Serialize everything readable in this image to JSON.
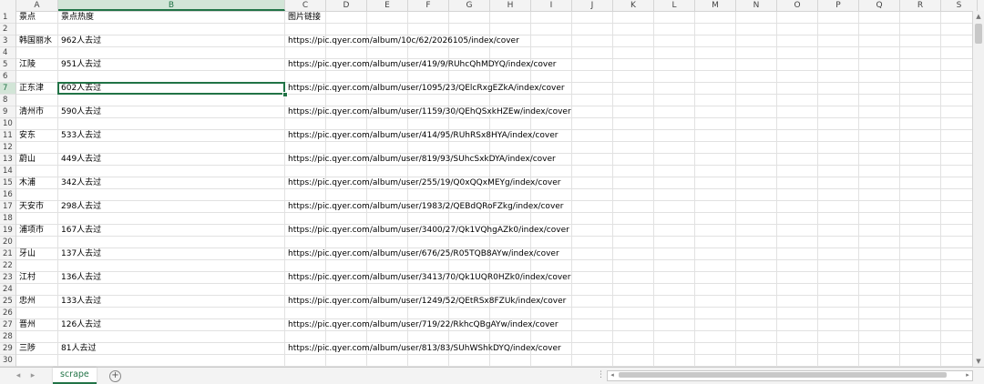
{
  "columns": [
    "A",
    "B",
    "C",
    "D",
    "E",
    "F",
    "G",
    "H",
    "I",
    "J",
    "K",
    "L",
    "M",
    "N",
    "O",
    "P",
    "Q",
    "R",
    "S"
  ],
  "selected_column": "B",
  "selected_row": "7",
  "row_numbers": [
    "1",
    "2",
    "3",
    "4",
    "5",
    "6",
    "7",
    "8",
    "9",
    "10",
    "11",
    "12",
    "13",
    "14",
    "15",
    "16",
    "17",
    "18",
    "19",
    "20",
    "21",
    "22",
    "23",
    "24",
    "25",
    "26",
    "27",
    "28",
    "29",
    "30"
  ],
  "header_row": {
    "a": "景点",
    "b": "景点热度",
    "c": "图片链接"
  },
  "rows": [
    {
      "row": 3,
      "a": "韩国丽水",
      "b": "962人去过",
      "c": "https://pic.qyer.com/album/10c/62/2026105/index/cover"
    },
    {
      "row": 5,
      "a": "江陵",
      "b": "951人去过",
      "c": "https://pic.qyer.com/album/user/419/9/RUhcQhMDYQ/index/cover"
    },
    {
      "row": 7,
      "a": "正东津",
      "b": "602人去过",
      "c": "https://pic.qyer.com/album/user/1095/23/QElcRxgEZkA/index/cover"
    },
    {
      "row": 9,
      "a": "清州市",
      "b": "590人去过",
      "c": "https://pic.qyer.com/album/user/1159/30/QEhQSxkHZEw/index/cover"
    },
    {
      "row": 11,
      "a": "安东",
      "b": "533人去过",
      "c": "https://pic.qyer.com/album/user/414/95/RUhRSx8HYA/index/cover"
    },
    {
      "row": 13,
      "a": "蔚山",
      "b": "449人去过",
      "c": "https://pic.qyer.com/album/user/819/93/SUhcSxkDYA/index/cover"
    },
    {
      "row": 15,
      "a": "木浦",
      "b": "342人去过",
      "c": "https://pic.qyer.com/album/user/255/19/Q0xQQxMEYg/index/cover"
    },
    {
      "row": 17,
      "a": "天安市",
      "b": "298人去过",
      "c": "https://pic.qyer.com/album/user/1983/2/QEBdQRoFZkg/index/cover"
    },
    {
      "row": 19,
      "a": "浦项市",
      "b": "167人去过",
      "c": "https://pic.qyer.com/album/user/3400/27/Qk1VQhgAZk0/index/cover"
    },
    {
      "row": 21,
      "a": "牙山",
      "b": "137人去过",
      "c": "https://pic.qyer.com/album/user/676/25/R05TQB8AYw/index/cover"
    },
    {
      "row": 23,
      "a": "江村",
      "b": "136人去过",
      "c": "https://pic.qyer.com/album/user/3413/70/Qk1UQR0HZk0/index/cover"
    },
    {
      "row": 25,
      "a": "忠州",
      "b": "133人去过",
      "c": "https://pic.qyer.com/album/user/1249/52/QEtRSx8FZUk/index/cover"
    },
    {
      "row": 27,
      "a": "晋州",
      "b": "126人去过",
      "c": "https://pic.qyer.com/album/user/719/22/RkhcQBgAYw/index/cover"
    },
    {
      "row": 29,
      "a": "三陟",
      "b": "81人去过",
      "c": "https://pic.qyer.com/album/user/813/83/SUhWShkDYQ/index/cover"
    }
  ],
  "sheet_tab": "scrape",
  "add_sheet_icon": "plus-circle-icon",
  "colors": {
    "accent": "#217346",
    "selected_header": "#d2e5d7",
    "gridline": "#e1e1e1"
  }
}
